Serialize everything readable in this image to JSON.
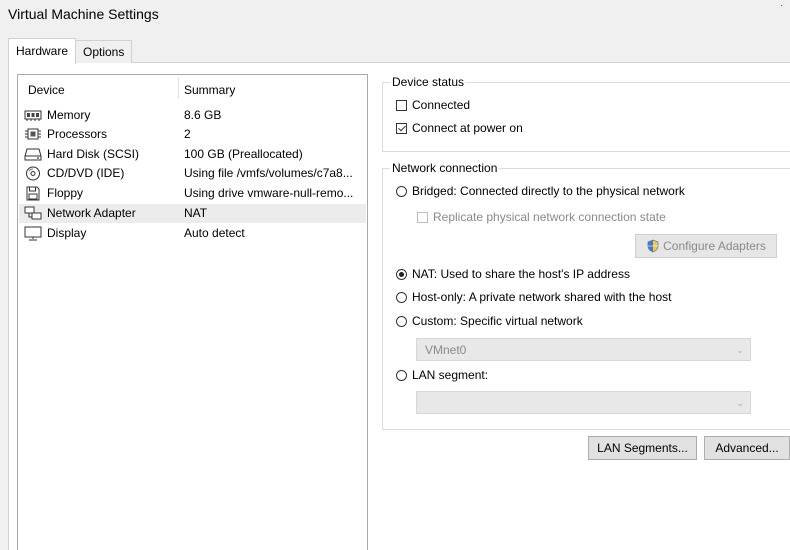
{
  "window": {
    "title": "Virtual Machine Settings"
  },
  "tabs": [
    {
      "label": "Hardware",
      "active": true
    },
    {
      "label": "Options",
      "active": false
    }
  ],
  "device_list": {
    "columns": [
      "Device",
      "Summary"
    ],
    "rows": [
      {
        "icon": "memory-icon",
        "device": "Memory",
        "summary": "8.6 GB"
      },
      {
        "icon": "processor-icon",
        "device": "Processors",
        "summary": "2"
      },
      {
        "icon": "hard-disk-icon",
        "device": "Hard Disk (SCSI)",
        "summary": "100 GB (Preallocated)"
      },
      {
        "icon": "cd-dvd-icon",
        "device": "CD/DVD (IDE)",
        "summary": "Using file /vmfs/volumes/c7a8..."
      },
      {
        "icon": "floppy-icon",
        "device": "Floppy",
        "summary": "Using drive vmware-null-remo..."
      },
      {
        "icon": "network-adapter-icon",
        "device": "Network Adapter",
        "summary": "NAT",
        "selected": true
      },
      {
        "icon": "display-icon",
        "device": "Display",
        "summary": "Auto detect"
      }
    ]
  },
  "device_status": {
    "label": "Device status",
    "connected": {
      "label": "Connected",
      "checked": false
    },
    "connect_at_power_on": {
      "label": "Connect at power on",
      "checked": true
    }
  },
  "network_connection": {
    "label": "Network connection",
    "bridged": "Bridged: Connected directly to the physical network",
    "replicate": "Replicate physical network connection state",
    "configure_adapters": "Configure Adapters",
    "nat": "NAT: Used to share the host's IP address",
    "host_only": "Host-only: A private network shared with the host",
    "custom": "Custom: Specific virtual network",
    "vmnet_value": "VMnet0",
    "lan_segment": "LAN segment:",
    "lan_segment_value": "",
    "selected": "nat"
  },
  "buttons": {
    "lan_segments": "LAN Segments...",
    "advanced": "Advanced..."
  }
}
